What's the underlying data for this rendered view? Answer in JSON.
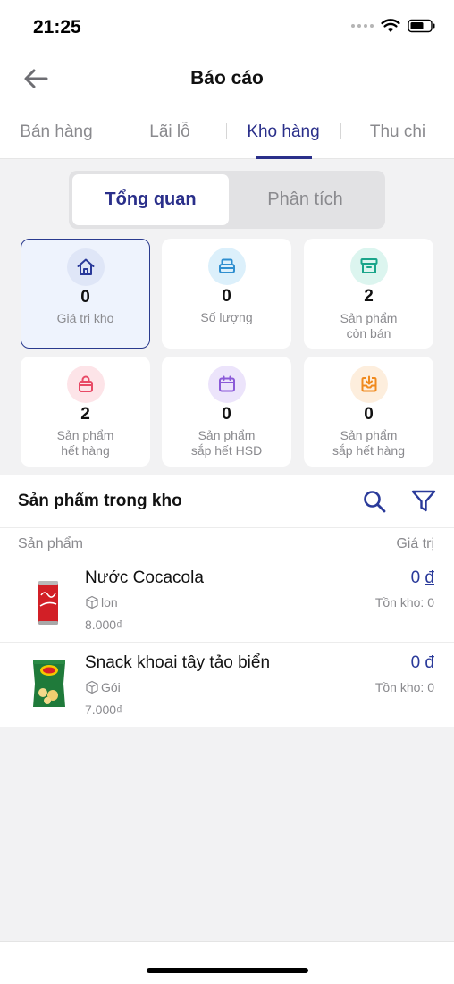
{
  "status_bar": {
    "time": "21:25"
  },
  "header": {
    "title": "Báo cáo"
  },
  "tabs": [
    {
      "label": "Bán hàng"
    },
    {
      "label": "Lãi lỗ"
    },
    {
      "label": "Kho hàng",
      "active": true
    },
    {
      "label": "Thu chi"
    }
  ],
  "segment": {
    "overview": "Tổng quan",
    "analysis": "Phân tích"
  },
  "cards": [
    {
      "value": "0",
      "label": "Giá trị kho",
      "icon": "home-icon",
      "color": "#2a3a9a",
      "bg": "#dfe6f7"
    },
    {
      "value": "0",
      "label": "Số lượng",
      "icon": "box-icon",
      "color": "#2f8fd0",
      "bg": "#dcf0fb"
    },
    {
      "value": "2",
      "label": "Sản phẩm\ncòn bán",
      "icon": "archive-icon",
      "color": "#1aa58a",
      "bg": "#dcf5ef"
    },
    {
      "value": "2",
      "label": "Sản phẩm\nhết hàng",
      "icon": "bag-icon",
      "color": "#e84a66",
      "bg": "#fde4e8"
    },
    {
      "value": "0",
      "label": "Sản phẩm\nsắp hết HSD",
      "icon": "calendar-icon",
      "color": "#8b5ad8",
      "bg": "#ece4fb"
    },
    {
      "value": "0",
      "label": "Sản phẩm\nsắp hết hàng",
      "icon": "inbox-download-icon",
      "color": "#f08a1e",
      "bg": "#fdeedd"
    }
  ],
  "inventory": {
    "title": "Sản phẩm trong kho",
    "col_product": "Sản phẩm",
    "col_value": "Giá trị",
    "items": [
      {
        "name": "Nước Cocacola",
        "unit": "lon",
        "price": "8.000₫",
        "value": "0",
        "currency": "đ",
        "stock": "Tồn kho: 0",
        "image": "cola-can-image"
      },
      {
        "name": "Snack khoai tây tảo biển",
        "unit": "Gói",
        "price": "7.000₫",
        "value": "0",
        "currency": "đ",
        "stock": "Tồn kho: 0",
        "image": "snack-bag-image"
      }
    ]
  }
}
